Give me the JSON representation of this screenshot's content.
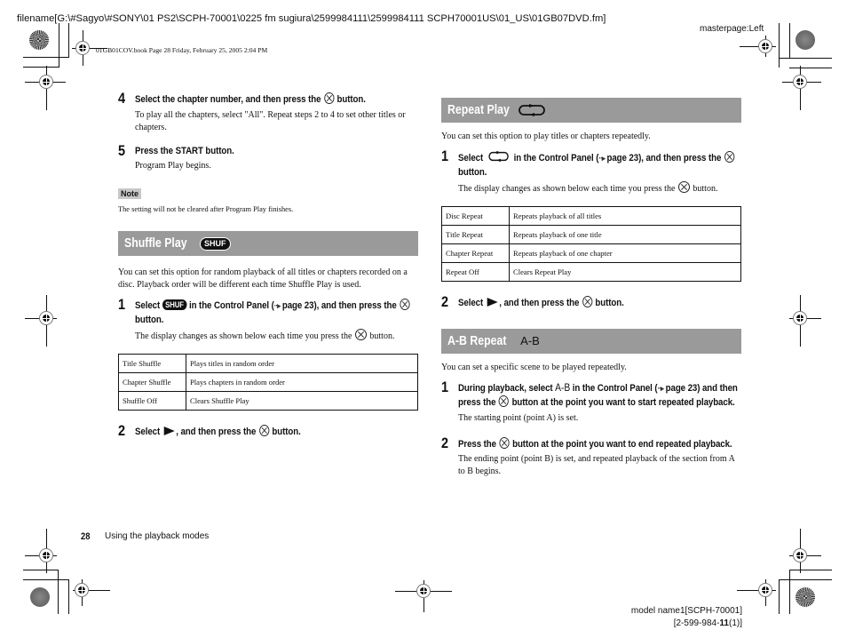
{
  "meta": {
    "filename": "filename[G:\\#Sagyo\\#SONY\\01 PS2\\SCPH-70001\\0225 fm sugiura\\2599984111\\2599984111 SCPH70001US\\01_US\\01GB07DVD.fm]",
    "book_info": "01GB01COV.book  Page 28  Friday, February 25, 2005  2:04 PM",
    "masterpage": "masterpage:Left",
    "page_number": "28",
    "footer_title": "Using the playback modes",
    "model_name": "model name1[SCPH-70001]",
    "part_number_prefix": "[2-599-984-",
    "part_number_bold": "11",
    "part_number_suffix": "(1)]"
  },
  "left": {
    "step4": {
      "num": "4",
      "head_a": "Select the chapter number, and then press the",
      "head_b": "button.",
      "body": "To play all the chapters, select \"All\". Repeat steps 2 to 4 to set other titles or chapters."
    },
    "step5": {
      "num": "5",
      "head": "Press the START button.",
      "body": "Program Play begins."
    },
    "note": {
      "label": "Note",
      "text": "The setting will not be cleared after Program Play finishes."
    },
    "shuffle": {
      "title": "Shuffle Play",
      "icon": "SHUF",
      "intro": "You can set this option for random playback of all titles or chapters recorded on a disc. Playback order will be different each time Shuffle Play is used.",
      "step1": {
        "num": "1",
        "head_a": "Select",
        "head_b": "in the Control Panel (",
        "head_ref": "page 23), and then press the",
        "head_c": "button.",
        "body_a": "The display changes as shown below each time you press the",
        "body_b": "button."
      },
      "table": [
        {
          "mode": "Title Shuffle",
          "desc": "Plays titles in random order"
        },
        {
          "mode": "Chapter Shuffle",
          "desc": "Plays chapters in random order"
        },
        {
          "mode": "Shuffle Off",
          "desc": "Clears Shuffle Play"
        }
      ],
      "step2": {
        "num": "2",
        "head_a": "Select",
        "head_b": ", and then press the",
        "head_c": "button."
      }
    }
  },
  "right": {
    "repeat": {
      "title": "Repeat Play",
      "intro": "You can set this option to play titles or chapters repeatedly.",
      "step1": {
        "num": "1",
        "head_a": "Select",
        "head_b": "in the Control Panel (",
        "head_ref": "page 23), and then press the",
        "head_c": "button.",
        "body_a": "The display changes as shown below each time you press the",
        "body_b": "button."
      },
      "table": [
        {
          "mode": "Disc Repeat",
          "desc": "Repeats playback of all titles"
        },
        {
          "mode": "Title Repeat",
          "desc": "Repeats playback of one title"
        },
        {
          "mode": "Chapter Repeat",
          "desc": "Repeats playback of one chapter"
        },
        {
          "mode": "Repeat Off",
          "desc": "Clears Repeat Play"
        }
      ],
      "step2": {
        "num": "2",
        "head_a": "Select",
        "head_b": ", and then press the",
        "head_c": "button."
      }
    },
    "ab": {
      "title": "A-B Repeat",
      "icon": "A-B",
      "intro": "You can set a specific scene to be played repeatedly.",
      "step1": {
        "num": "1",
        "head_a": "During playback, select",
        "head_icon": "A-B",
        "head_b": "in the Control Panel (",
        "head_ref": "page 23) and then press the",
        "head_c": "button at the point you want to start repeated playback.",
        "body": "The starting point (point A) is set."
      },
      "step2": {
        "num": "2",
        "head_a": "Press the",
        "head_b": "button at the point you want to end repeated playback.",
        "body": "The ending point (point B) is set, and repeated playback of the section from A to B begins."
      }
    }
  },
  "colors": {
    "section_bar": "#9a9a9a",
    "note_badge": "#c8c8c8",
    "text": "#111111"
  }
}
